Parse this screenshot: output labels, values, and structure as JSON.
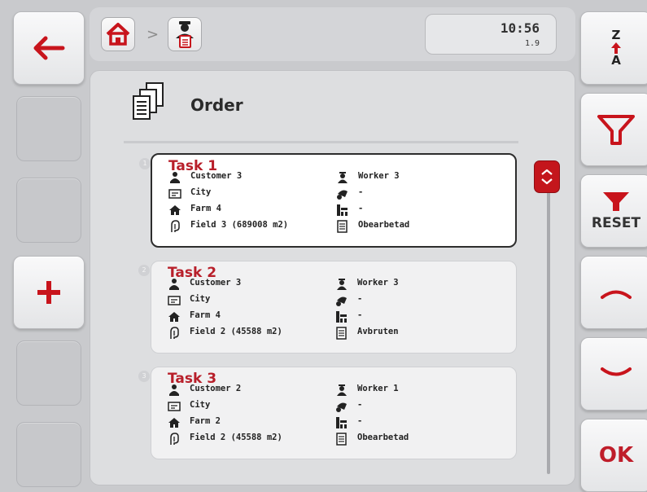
{
  "header": {
    "time": "10:56",
    "version": "1.9",
    "breadcrumb_separator": ">"
  },
  "page": {
    "title": "Order"
  },
  "right_buttons": {
    "sort_top": "Z",
    "sort_bottom": "A",
    "reset_label": "RESET",
    "ok_label": "OK"
  },
  "tasks": [
    {
      "number": "1",
      "title": "Task 1",
      "customer": "Customer 3",
      "address": "City",
      "farm": "Farm 4",
      "field": "Field 3 (689008 m2)",
      "worker": "Worker 3",
      "machine": "-",
      "operation": "-",
      "status": "Obearbetad"
    },
    {
      "number": "2",
      "title": "Task 2",
      "customer": "Customer 3",
      "address": "City",
      "farm": "Farm 4",
      "field": "Field 2 (45588 m2)",
      "worker": "Worker 3",
      "machine": "-",
      "operation": "-",
      "status": "Avbruten"
    },
    {
      "number": "3",
      "title": "Task 3",
      "customer": "Customer 2",
      "address": "City",
      "farm": "Farm 2",
      "field": "Field 2 (45588 m2)",
      "worker": "Worker 1",
      "machine": "-",
      "operation": "-",
      "status": "Obearbetad"
    }
  ],
  "colors": {
    "accent": "#c4161c",
    "task_title": "#b81f2a",
    "background": "#c9cacd"
  }
}
